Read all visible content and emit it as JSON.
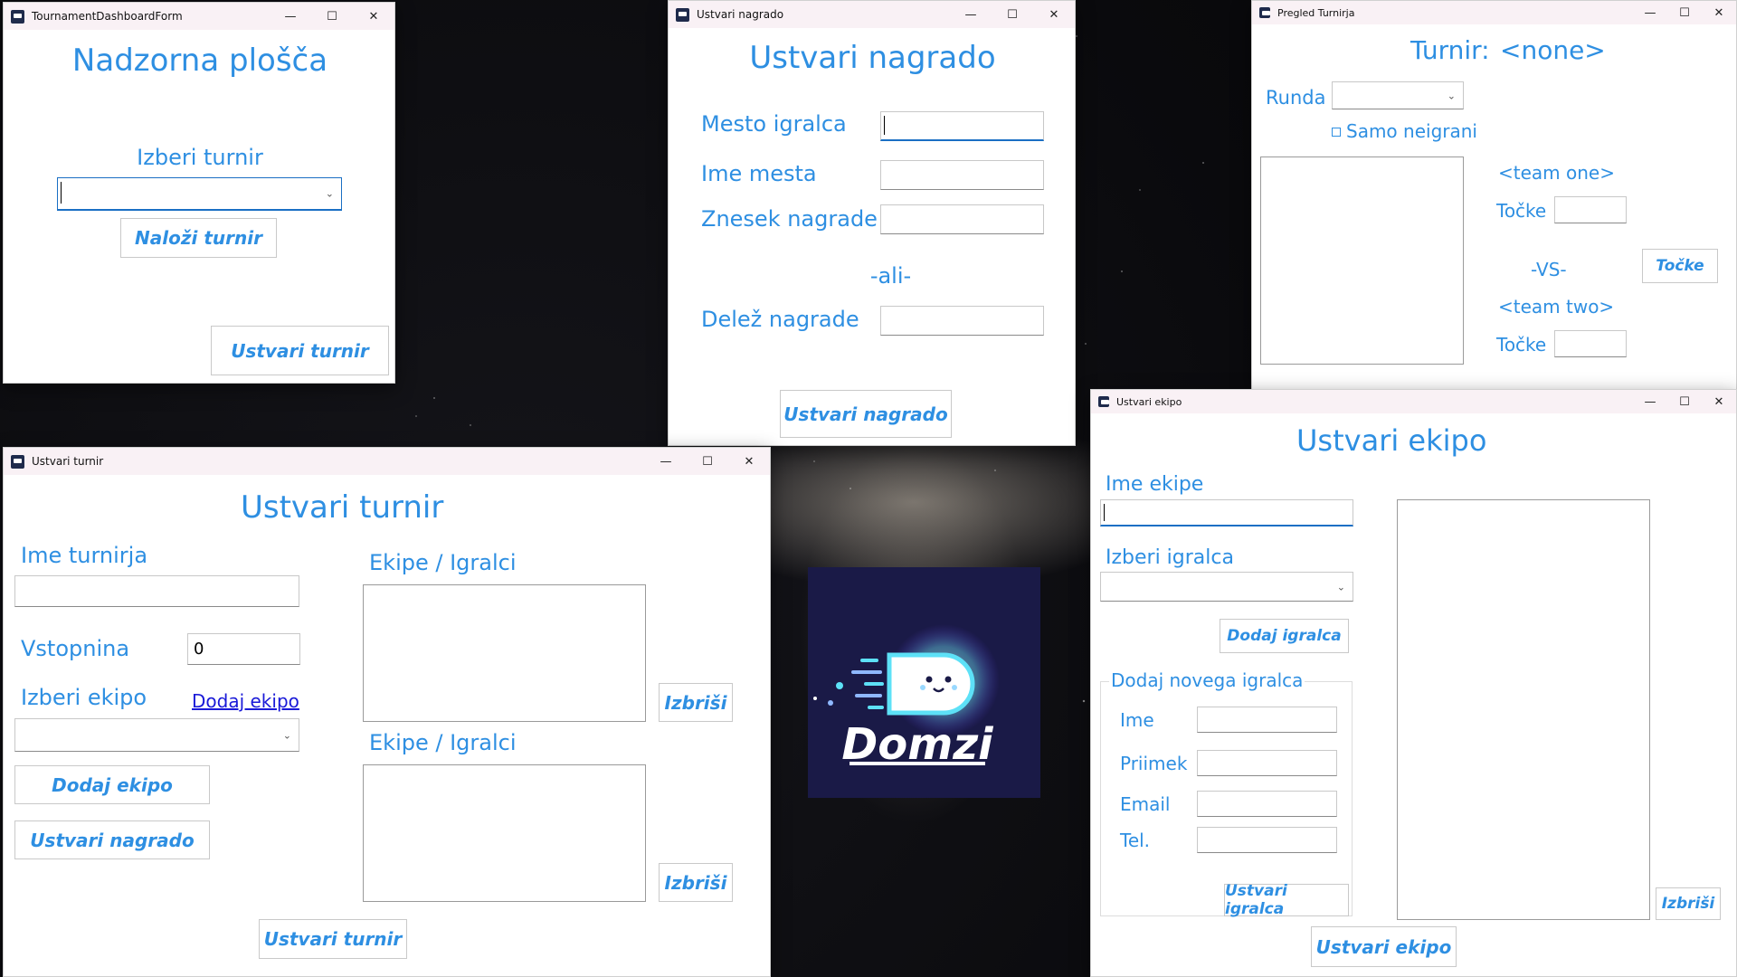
{
  "desktop": {
    "background": "starfield-milky-way"
  },
  "logo": {
    "text": "Domzi",
    "bg_color": "#1a1a47"
  },
  "icons": {
    "minimize": "—",
    "maximize": "☐",
    "close": "✕",
    "chevron": "⌄"
  },
  "dashboard": {
    "title": "TournamentDashboardForm",
    "heading": "Nadzorna plošča",
    "select_label": "Izberi turnir",
    "load_button": "Naloži turnir",
    "create_button": "Ustvari turnir"
  },
  "prize": {
    "title": "Ustvari nagrado",
    "heading": "Ustvari nagrado",
    "place_number_label": "Mesto igralca",
    "place_name_label": "Ime mesta",
    "amount_label": "Znesek nagrade",
    "or_label": "-ali-",
    "percentage_label": "Delež nagrade",
    "create_button": "Ustvari nagrado"
  },
  "viewer": {
    "title": "Pregled Turnirja",
    "tournament_label": "Turnir:",
    "tournament_name": "<none>",
    "round_label": "Runda",
    "unplayed_label": "Samo neigrani",
    "team_one": "<team one>",
    "score_label_1": "Točke",
    "vs_label": "-VS-",
    "team_two": "<team two>",
    "score_label_2": "Točke",
    "score_button": "Točke"
  },
  "tournament": {
    "title": "Ustvari turnir",
    "heading": "Ustvari turnir",
    "name_label": "Ime turnirja",
    "fee_label": "Vstopnina",
    "fee_value": "0",
    "team_label": "Izberi ekipo",
    "new_team_link": "Dodaj ekipo",
    "add_team_button": "Dodaj ekipo",
    "create_prize_button": "Ustvari nagrado",
    "teams_list_label": "Ekipe / Igralci",
    "prizes_list_label": "Ekipe / Igralci",
    "delete_button_1": "Izbriši",
    "delete_button_2": "Izbriši",
    "create_button": "Ustvari turnir"
  },
  "team": {
    "title": "Ustvari ekipo",
    "heading": "Ustvari ekipo",
    "name_label": "Ime ekipe",
    "select_member_label": "Izberi igralca",
    "add_member_button": "Dodaj igralca",
    "new_member_group": "Dodaj novega igralca",
    "first_name_label": "Ime",
    "last_name_label": "Priimek",
    "email_label": "Email",
    "phone_label": "Tel.",
    "create_member_button": "Ustvari igralca",
    "delete_button": "Izbriši",
    "create_button": "Ustvari ekipo"
  }
}
